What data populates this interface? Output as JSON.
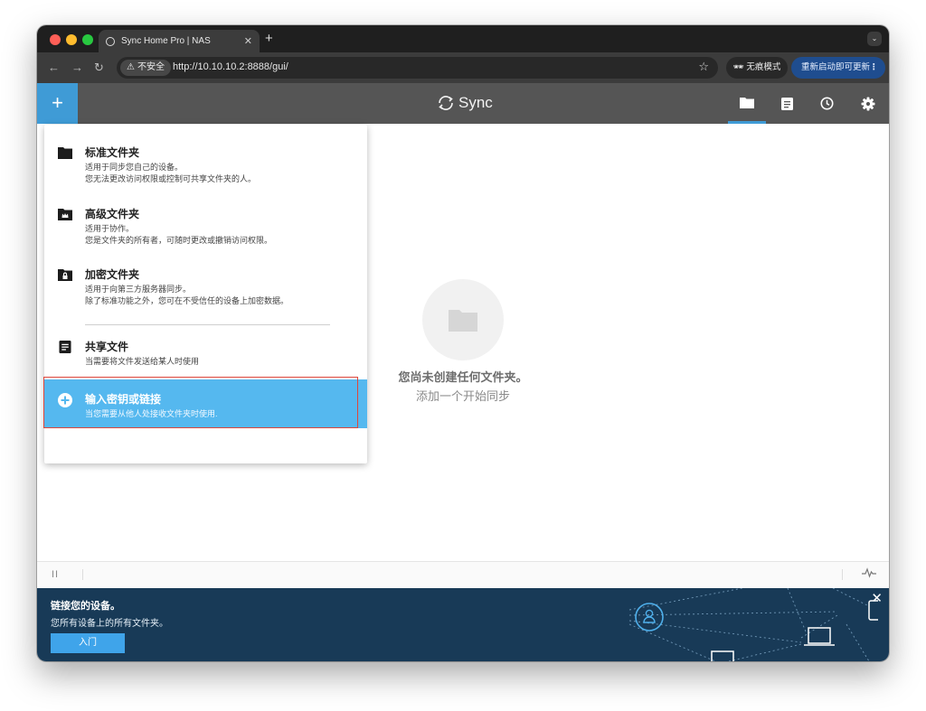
{
  "browser": {
    "tab_title": "Sync Home Pro | NAS",
    "insecure_label": "不安全",
    "url": "http://10.10.10.2:8888/gui/",
    "incognito_label": "无痕模式",
    "update_label": "重新启动即可更新"
  },
  "app": {
    "logo_text": "Sync",
    "accent_color": "#3f9bd6",
    "header_icons": [
      "folder-icon",
      "document-icon",
      "history-icon",
      "settings-icon"
    ]
  },
  "menu": {
    "items": [
      {
        "icon": "folder-icon",
        "title": "标准文件夹",
        "desc1": "适用于同步您自己的设备。",
        "desc2": "您无法更改访问权限或控制可共享文件夹的人。"
      },
      {
        "icon": "crown-folder-icon",
        "title": "高级文件夹",
        "desc1": "适用于协作。",
        "desc2": "您是文件夹的所有者，可随时更改或撤销访问权限。"
      },
      {
        "icon": "lock-folder-icon",
        "title": "加密文件夹",
        "desc1": "适用于向第三方服务器同步。",
        "desc2": "除了标准功能之外，您可在不受信任的设备上加密数据。"
      },
      {
        "icon": "document-icon",
        "title": "共享文件",
        "desc1": "当需要将文件发送给某人时使用"
      },
      {
        "icon": "plus-circle-icon",
        "title": "输入密钥或链接",
        "desc1": "当您需要从他人处接收文件夹时使用."
      }
    ]
  },
  "empty_state": {
    "line1": "您尚未创建任何文件夹。",
    "line2": "添加一个开始同步"
  },
  "banner": {
    "title": "链接您的设备。",
    "subtitle": "您所有设备上的所有文件夹。",
    "button": "入门"
  }
}
